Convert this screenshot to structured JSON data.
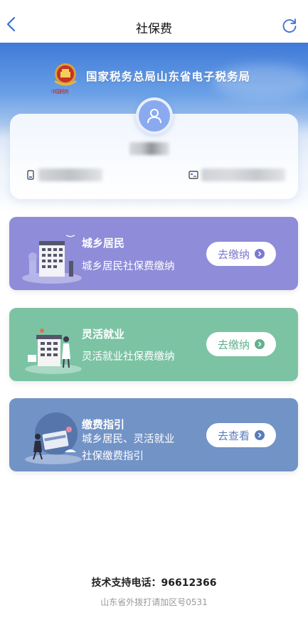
{
  "nav": {
    "title": "社保费"
  },
  "banner": {
    "bureau_name": "国家税务总局山东省电子税务局",
    "emblem_caption": "中国税务"
  },
  "services": [
    {
      "title": "城乡居民",
      "subtitle_lines": [
        "城乡居民社保费缴纳"
      ],
      "button": "去缴纳",
      "color": "#8f8cd9",
      "accent": "#7c79cf"
    },
    {
      "title": "灵活就业",
      "subtitle_lines": [
        "灵活就业社保费缴纳"
      ],
      "button": "去缴纳",
      "color": "#7cc3a4",
      "accent": "#62b18f"
    },
    {
      "title": "缴费指引",
      "subtitle_lines": [
        "城乡居民、灵活就业",
        "社保缴费指引"
      ],
      "button": "去查看",
      "color": "#7293c6",
      "accent": "#5a7db8"
    }
  ],
  "footer": {
    "support": "技术支持电话：96612366",
    "note": "山东省外拨打请加区号0531"
  },
  "icons": [
    "back-icon",
    "refresh-icon",
    "user-icon",
    "phone-icon",
    "id-card-icon",
    "chevron-right-icon"
  ]
}
